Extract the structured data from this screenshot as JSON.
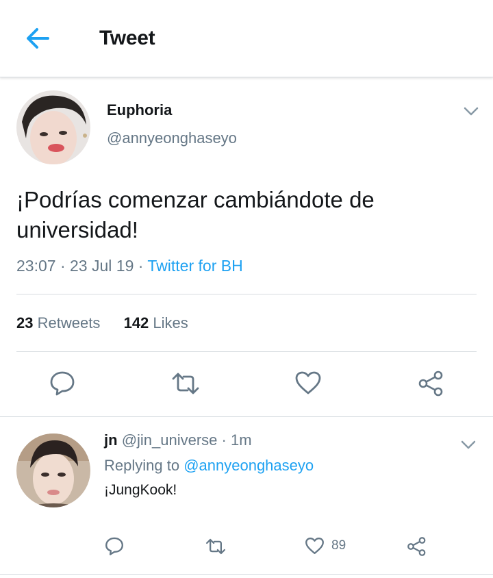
{
  "colors": {
    "accent": "#1da1f2",
    "text": "#14171a",
    "muted": "#657786",
    "divider": "#d6dbe0"
  },
  "header": {
    "back_icon": "arrow-left-icon",
    "title": "Tweet"
  },
  "tweet": {
    "name": "Euphoria",
    "handle": "@annyeonghaseyo",
    "text_line1": "¡Podrías comenzar cambiándote de",
    "text_line2": "universidad!",
    "time": "23:07",
    "date": "23 Jul 19",
    "source": "Twitter for BH",
    "retweets_count": "23",
    "retweets_label": "Retweets",
    "likes_count": "142",
    "likes_label": "Likes",
    "actions": [
      "reply-icon",
      "retweet-icon",
      "like-icon",
      "share-icon"
    ]
  },
  "reply": {
    "name": "jn",
    "handle": "@jin_universe",
    "time": "1m",
    "replying_prefix": "Replying to",
    "replying_to": "@annyeonghaseyo",
    "text": "¡JungKook!",
    "like_count": "89"
  }
}
